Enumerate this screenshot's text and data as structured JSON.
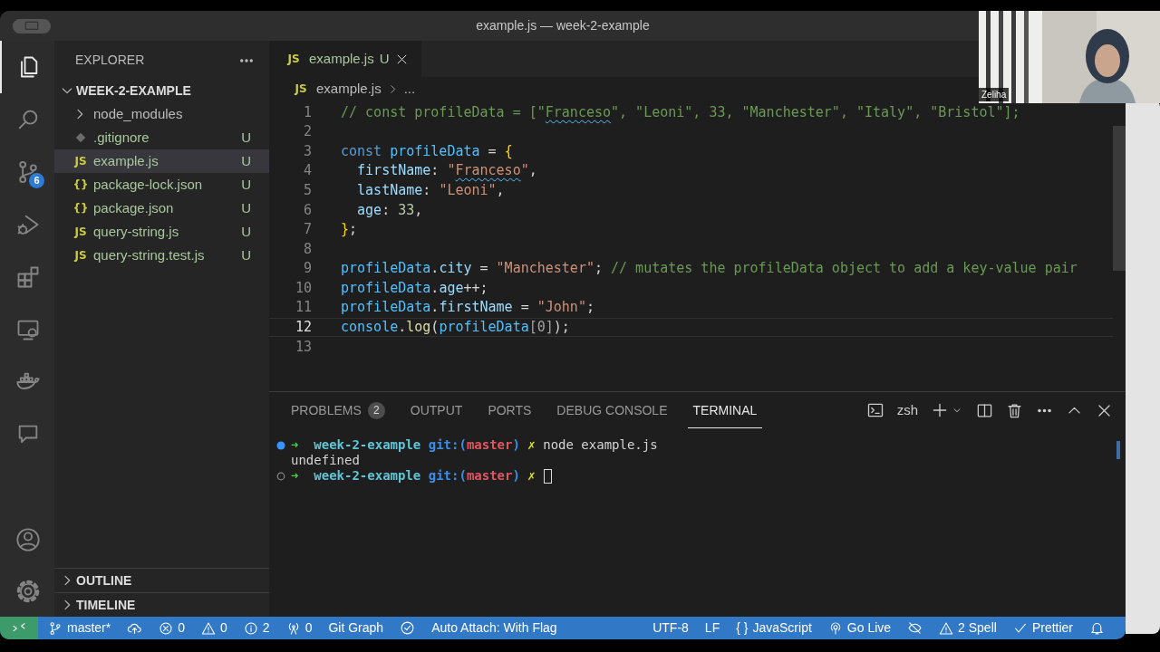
{
  "window": {
    "title": "example.js — week-2-example"
  },
  "activity_bar": {
    "top": [
      {
        "selected": true
      },
      {
        "selected": false
      },
      {
        "selected": false,
        "badge": "6"
      },
      {
        "selected": false
      },
      {
        "selected": false
      },
      {
        "selected": false
      },
      {
        "selected": false
      },
      {
        "selected": false
      }
    ]
  },
  "sidebar": {
    "title": "EXPLORER",
    "root": {
      "label": "WEEK-2-EXAMPLE",
      "expanded": true,
      "children": [
        {
          "label": "node_modules",
          "kind": "folder",
          "expanded": false,
          "selected": false
        },
        {
          "label": ".gitignore",
          "kind": "git",
          "status": "U",
          "selected": false
        },
        {
          "label": "example.js",
          "kind": "file",
          "icon_text": "JS",
          "status": "U",
          "selected": true
        },
        {
          "label": "package-lock.json",
          "kind": "file",
          "icon_text": "{}",
          "status": "U",
          "selected": false
        },
        {
          "label": "package.json",
          "kind": "file",
          "icon_text": "{}",
          "status": "U",
          "selected": false
        },
        {
          "label": "query-string.js",
          "kind": "file",
          "icon_text": "JS",
          "status": "U",
          "selected": false
        },
        {
          "label": "query-string.test.js",
          "kind": "file",
          "icon_text": "JS",
          "status": "U",
          "selected": false
        }
      ]
    },
    "sections": [
      {
        "label": "OUTLINE",
        "expanded": false
      },
      {
        "label": "TIMELINE",
        "expanded": false
      }
    ]
  },
  "editor": {
    "tabs": [
      {
        "icon_text": "JS",
        "label": "example.js",
        "status": "U",
        "selected": true
      }
    ],
    "breadcrumb": {
      "icon_text": "JS",
      "file": "example.js",
      "rest": "..."
    },
    "lines": [
      {
        "number": "1",
        "current": false,
        "tokens": [
          {
            "text": "// const profileData = [\"",
            "kind": "comment"
          },
          {
            "text": "Franceso",
            "kind": "comment",
            "spell": true
          },
          {
            "text": "\", \"Leoni\", 33, \"Manchester\", \"Italy\", \"Bristol\"];",
            "kind": "comment"
          }
        ]
      },
      {
        "number": "2",
        "current": false
      },
      {
        "number": "3",
        "current": false,
        "tokens": [
          {
            "text": "const",
            "kind": "keyword"
          },
          {
            "text": " profileData",
            "kind": "var"
          },
          {
            "text": " = ",
            "kind": "plain"
          },
          {
            "text": "{",
            "kind": "brace"
          }
        ]
      },
      {
        "number": "4",
        "current": false,
        "tokens": [
          {
            "text": "  firstName",
            "kind": "prop"
          },
          {
            "text": ": ",
            "kind": "plain"
          },
          {
            "text": "\"",
            "kind": "string"
          },
          {
            "text": "Franceso",
            "kind": "string",
            "spell": true
          },
          {
            "text": "\"",
            "kind": "string"
          },
          {
            "text": ",",
            "kind": "plain"
          }
        ]
      },
      {
        "number": "5",
        "current": false,
        "tokens": [
          {
            "text": "  lastName",
            "kind": "prop"
          },
          {
            "text": ": ",
            "kind": "plain"
          },
          {
            "text": "\"Leoni\"",
            "kind": "string"
          },
          {
            "text": ",",
            "kind": "plain"
          }
        ]
      },
      {
        "number": "6",
        "current": false,
        "tokens": [
          {
            "text": "  age",
            "kind": "prop"
          },
          {
            "text": ": ",
            "kind": "plain"
          },
          {
            "text": "33",
            "kind": "number"
          },
          {
            "text": ",",
            "kind": "plain"
          }
        ]
      },
      {
        "number": "7",
        "current": false,
        "tokens": [
          {
            "text": "}",
            "kind": "brace"
          },
          {
            "text": ";",
            "kind": "plain"
          }
        ]
      },
      {
        "number": "8",
        "current": false
      },
      {
        "number": "9",
        "current": false,
        "tokens": [
          {
            "text": "profileData",
            "kind": "var"
          },
          {
            "text": ".",
            "kind": "plain"
          },
          {
            "text": "city",
            "kind": "prop"
          },
          {
            "text": " = ",
            "kind": "plain"
          },
          {
            "text": "\"Manchester\"",
            "kind": "string"
          },
          {
            "text": "; ",
            "kind": "plain"
          },
          {
            "text": "// mutates the profileData object to add a key-value pair",
            "kind": "comment"
          }
        ]
      },
      {
        "number": "10",
        "current": false,
        "tokens": [
          {
            "text": "profileData",
            "kind": "var"
          },
          {
            "text": ".",
            "kind": "plain"
          },
          {
            "text": "age",
            "kind": "prop"
          },
          {
            "text": "++;",
            "kind": "plain"
          }
        ]
      },
      {
        "number": "11",
        "current": false,
        "tokens": [
          {
            "text": "profileData",
            "kind": "var"
          },
          {
            "text": ".",
            "kind": "plain"
          },
          {
            "text": "firstName",
            "kind": "prop"
          },
          {
            "text": " = ",
            "kind": "plain"
          },
          {
            "text": "\"John\"",
            "kind": "string"
          },
          {
            "text": ";",
            "kind": "plain"
          }
        ]
      },
      {
        "number": "12",
        "current": true,
        "tokens": [
          {
            "text": "console",
            "kind": "var"
          },
          {
            "text": ".",
            "kind": "plain"
          },
          {
            "text": "log",
            "kind": "fn"
          },
          {
            "text": "(",
            "kind": "plain"
          },
          {
            "text": "profileData",
            "kind": "var"
          },
          {
            "text": "[0]",
            "kind": "dim"
          },
          {
            "text": ");",
            "kind": "plain"
          }
        ]
      },
      {
        "number": "13",
        "current": false
      }
    ]
  },
  "panel": {
    "tabs": [
      {
        "label": "PROBLEMS",
        "badge": "2",
        "selected": false
      },
      {
        "label": "OUTPUT",
        "selected": false
      },
      {
        "label": "PORTS",
        "selected": false
      },
      {
        "label": "DEBUG CONSOLE",
        "selected": false
      },
      {
        "label": "TERMINAL",
        "selected": true
      }
    ],
    "shell": "zsh",
    "terminal": [
      {
        "succeeded": true,
        "tokens": [
          {
            "text": "➜",
            "kind": "arrow"
          },
          {
            "text": "  week-2-example ",
            "kind": "dir"
          },
          {
            "text": "git:(",
            "kind": "git"
          },
          {
            "text": "master",
            "kind": "branch"
          },
          {
            "text": ")",
            "kind": "git"
          },
          {
            "text": " ✗ ",
            "kind": "dirty"
          },
          {
            "text": "node example.js",
            "kind": "plain"
          }
        ]
      },
      {
        "tokens": [
          {
            "text": "undefined",
            "kind": "plain"
          }
        ]
      },
      {
        "succeeded": false,
        "cursor": true,
        "tokens": [
          {
            "text": "➜",
            "kind": "arrow"
          },
          {
            "text": "  week-2-example ",
            "kind": "dir"
          },
          {
            "text": "git:(",
            "kind": "git"
          },
          {
            "text": "master",
            "kind": "branch"
          },
          {
            "text": ")",
            "kind": "git"
          },
          {
            "text": " ✗ ",
            "kind": "dirty"
          }
        ]
      }
    ]
  },
  "status_bar": {
    "left": [
      {
        "text": "master*"
      },
      {
        "text": "0"
      },
      {
        "text": "0"
      },
      {
        "text": "2"
      },
      {
        "text": "0"
      },
      {
        "text": "Git Graph"
      },
      {
        "text": "Auto Attach: With Flag"
      }
    ],
    "right": [
      {
        "text": "UTF-8"
      },
      {
        "text": "LF"
      },
      {
        "prefix": "{ }",
        "text": "JavaScript"
      },
      {
        "text": "Go Live"
      },
      {
        "text": "2 Spell"
      },
      {
        "text": "Prettier"
      }
    ]
  },
  "webcam": {
    "kind": "picture",
    "name_label": "Zeliha"
  }
}
